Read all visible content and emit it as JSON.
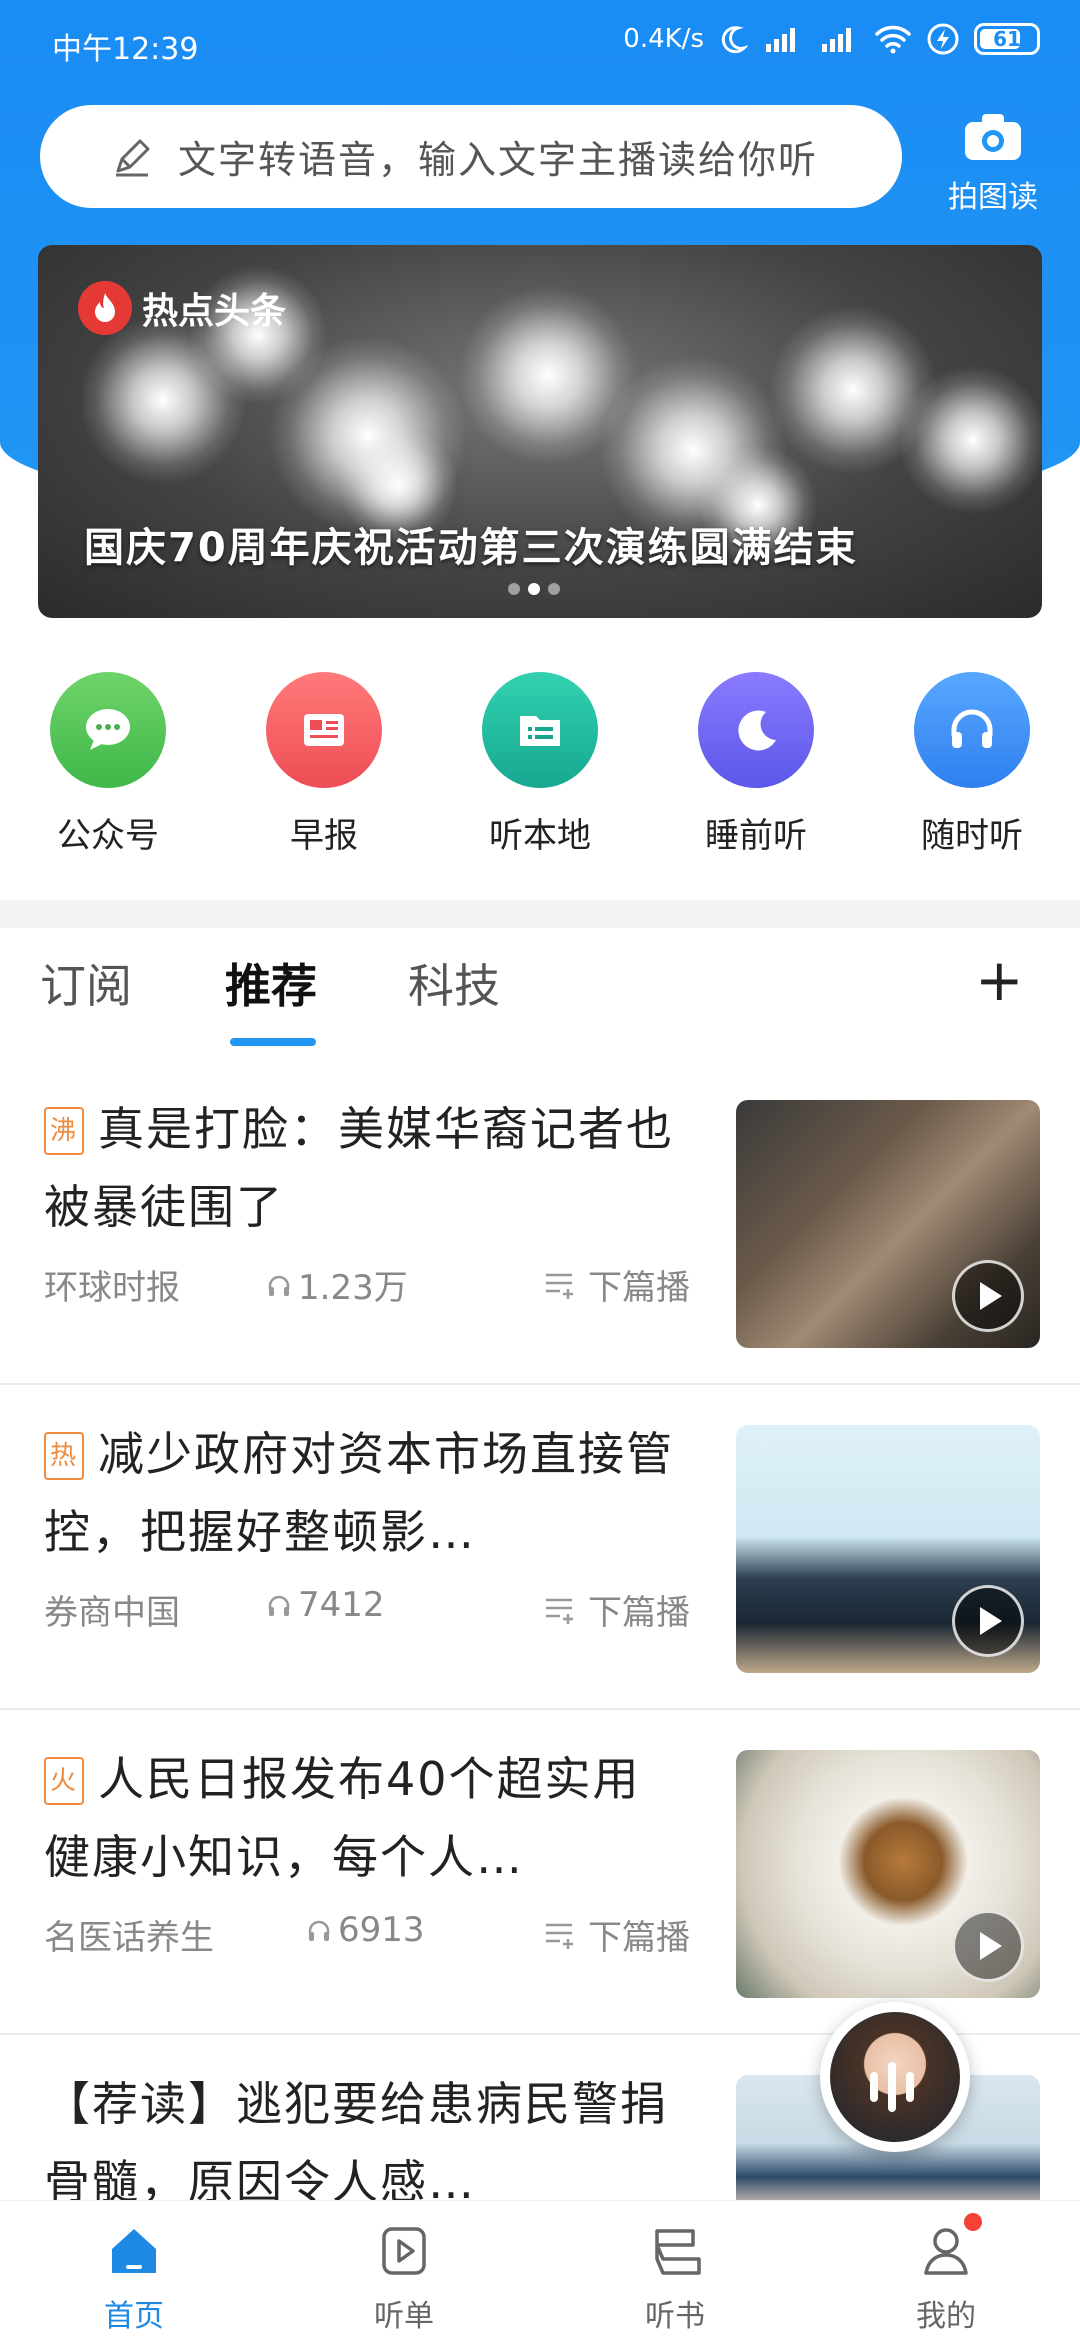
{
  "status_bar": {
    "time": "中午12:39",
    "network_speed": "0.4K/s",
    "battery": "61"
  },
  "search": {
    "placeholder": "文字转语音，输入文字主播读给你听",
    "icon": "pencil-icon"
  },
  "photo_read": {
    "label": "拍图读",
    "icon": "camera-icon"
  },
  "banner": {
    "tag": "热点头条",
    "title": "国庆70周年庆祝活动第三次演练圆满结束",
    "pages": 3,
    "active_page": 2
  },
  "quick_actions": [
    {
      "label": "公众号",
      "icon": "chat-bubble-icon",
      "color": "#4caf50"
    },
    {
      "label": "早报",
      "icon": "newspaper-icon",
      "color": "#f05454"
    },
    {
      "label": "听本地",
      "icon": "folder-list-icon",
      "color": "#1abc9c"
    },
    {
      "label": "睡前听",
      "icon": "moon-icon",
      "color": "#6c63ff"
    },
    {
      "label": "随时听",
      "icon": "headphones-icon",
      "color": "#2f8cf5"
    }
  ],
  "tabs": [
    {
      "label": "订阅",
      "active": false
    },
    {
      "label": "推荐",
      "active": true
    },
    {
      "label": "科技",
      "active": false
    }
  ],
  "feed": {
    "next_label": "下篇播",
    "items": [
      {
        "badge": "沸",
        "title": "真是打脸：美媒华裔记者也被暴徒围了",
        "source": "环球时报",
        "plays": "1.23万"
      },
      {
        "badge": "热",
        "title": "减少政府对资本市场直接管控，把握好整顿影…",
        "source": "券商中国",
        "plays": "7412"
      },
      {
        "badge": "火",
        "title": "人民日报发布40个超实用健康小知识，每个人…",
        "source": "名医话养生",
        "plays": "6913"
      },
      {
        "badge": "",
        "title": "【荐读】逃犯要给患病民警捐骨髓，原因令人感…",
        "source": "",
        "plays": ""
      }
    ]
  },
  "bottom_nav": [
    {
      "label": "首页",
      "icon": "home-icon",
      "active": true
    },
    {
      "label": "听单",
      "icon": "play-list-icon",
      "active": false
    },
    {
      "label": "听书",
      "icon": "book-icon",
      "active": false
    },
    {
      "label": "我的",
      "icon": "user-icon",
      "active": false,
      "has_notification": true
    }
  ],
  "colors": {
    "primary": "#2196f3",
    "badge": "#f08a3c"
  }
}
